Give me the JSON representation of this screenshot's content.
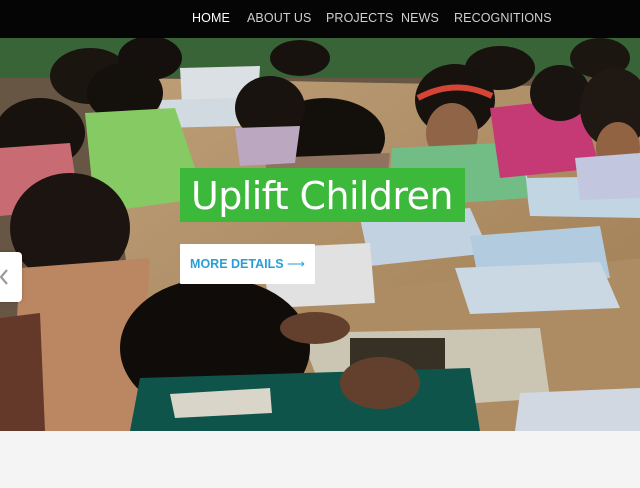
{
  "nav": {
    "items": [
      {
        "label": "HOME",
        "active": true
      },
      {
        "label": "ABOUT US",
        "active": false
      },
      {
        "label": "PROJECTS",
        "active": false
      },
      {
        "label": "NEWS",
        "active": false
      },
      {
        "label": "RECOGNITIONS",
        "active": false
      }
    ]
  },
  "hero": {
    "title": "Uplift Children",
    "button_label": "MORE DETAILS",
    "button_arrow": "⟶",
    "prev_icon": "chevron-left-icon"
  },
  "colors": {
    "navbar_bg": "#050505",
    "nav_text": "#cfcfcf",
    "nav_active": "#ffffff",
    "title_bg": "#3cb83a",
    "button_text": "#2a9fd6",
    "page_bg": "#f4f4f4"
  }
}
